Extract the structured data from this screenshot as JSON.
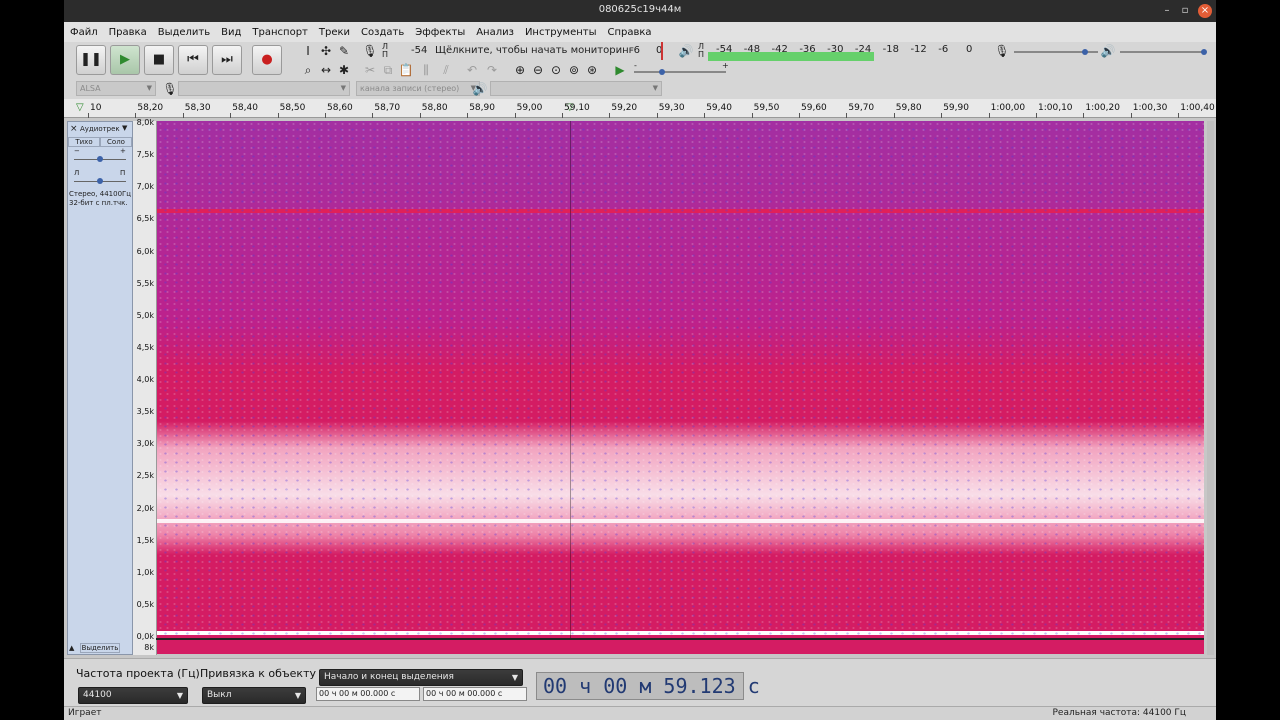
{
  "window": {
    "title": "080625с19ч44м"
  },
  "menu": [
    "Файл",
    "Правка",
    "Выделить",
    "Вид",
    "Транспорт",
    "Треки",
    "Создать",
    "Эффекты",
    "Анализ",
    "Инструменты",
    "Справка"
  ],
  "transport": {
    "pause_icon": "pause-icon",
    "play_icon": "play-icon",
    "stop_icon": "stop-icon",
    "skip_start_icon": "skip-start-icon",
    "skip_end_icon": "skip-end-icon",
    "record_icon": "record-icon"
  },
  "record_meter": {
    "lr_top": "Л",
    "lr_bottom": "П",
    "value_left": "-54",
    "hint": "Щёлкните, чтобы начать мониторинг",
    "v1": "-6",
    "v2": "0"
  },
  "play_meter": {
    "lr_top": "Л",
    "lr_bottom": "П",
    "scale": [
      "-54",
      "-48",
      "-42",
      "-36",
      "-30",
      "-24",
      "-18",
      "-12",
      "-6",
      "0"
    ],
    "level": 0.62
  },
  "mixer": {
    "rec_volume": 0.85,
    "play_volume": 1.0
  },
  "play_speed": {
    "minus": "-",
    "plus": "+",
    "value": 0.3
  },
  "device": {
    "host": "ALSA",
    "channels": "канала записи (стерео)"
  },
  "timeline": {
    "ticks": [
      "10",
      "58,20",
      "58,30",
      "58,40",
      "58,50",
      "58,60",
      "58,70",
      "58,80",
      "58,90",
      "59,00",
      "59,10",
      "59,20",
      "59,30",
      "59,40",
      "59,50",
      "59,60",
      "59,70",
      "59,80",
      "59,90",
      "1:00,00",
      "1:00,10",
      "1:00,20",
      "1:00,30",
      "1:00,40"
    ]
  },
  "track": {
    "name": "Аудиотрек",
    "mute": "Тихо",
    "solo": "Соло",
    "gain_minus": "−",
    "gain_plus": "+",
    "pan_left": "Л",
    "pan_right": "П",
    "info1": "Стерео, 44100Гц",
    "info2": "32-бит с пл.тчк.",
    "select": "Выделить",
    "close": "×"
  },
  "freq_axis": [
    "8,0k",
    "7,5k",
    "7,0k",
    "6,5k",
    "6,0k",
    "5,5k",
    "5,0k",
    "4,5k",
    "4,0k",
    "3,5k",
    "3,0k",
    "2,5k",
    "2,0k",
    "1,5k",
    "1,0k",
    "0,5k",
    "0,0k"
  ],
  "freq_axis_second": "8k",
  "colors": {
    "spectrogram_base": "#d41c63",
    "spectrogram_high": "#7b3fd6",
    "spectrogram_peak": "#ffffff"
  },
  "selection_bar": {
    "rate_label": "Частота проекта (Гц)",
    "rate_value": "44100",
    "snap_label": "Привязка к объекту",
    "snap_value": "Выкл",
    "sel_mode": "Начало и конец выделения",
    "sel_start": "00 ч 00 м 00.000 с",
    "sel_end": "00 ч 00 м 00.000 с",
    "position": "00 ч 00 м 59.123 с"
  },
  "status": {
    "left": "Играет",
    "right": "Реальная частота: 44100 Гц"
  }
}
